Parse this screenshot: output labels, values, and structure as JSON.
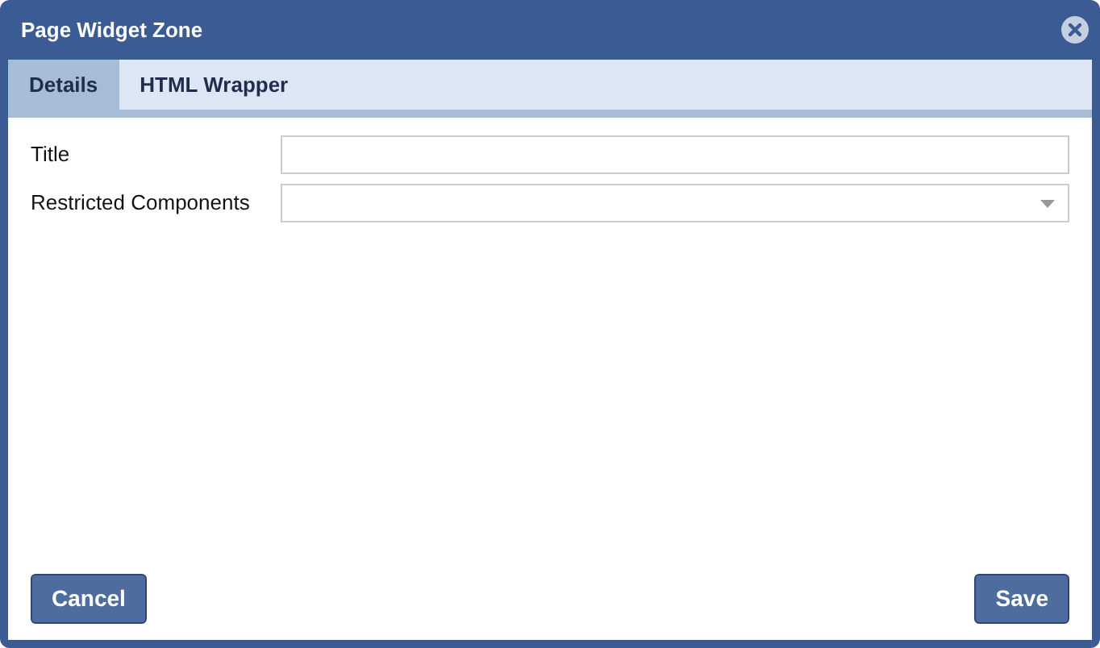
{
  "window": {
    "title": "Page Widget Zone"
  },
  "tabs": [
    {
      "label": "Details",
      "selected": true
    },
    {
      "label": "HTML Wrapper",
      "selected": false
    }
  ],
  "fields": [
    {
      "label": "Title",
      "kind": "text"
    },
    {
      "label": "Restricted Components",
      "kind": "select"
    }
  ],
  "buttons": {
    "cancel": "Cancel",
    "save": "Save"
  }
}
